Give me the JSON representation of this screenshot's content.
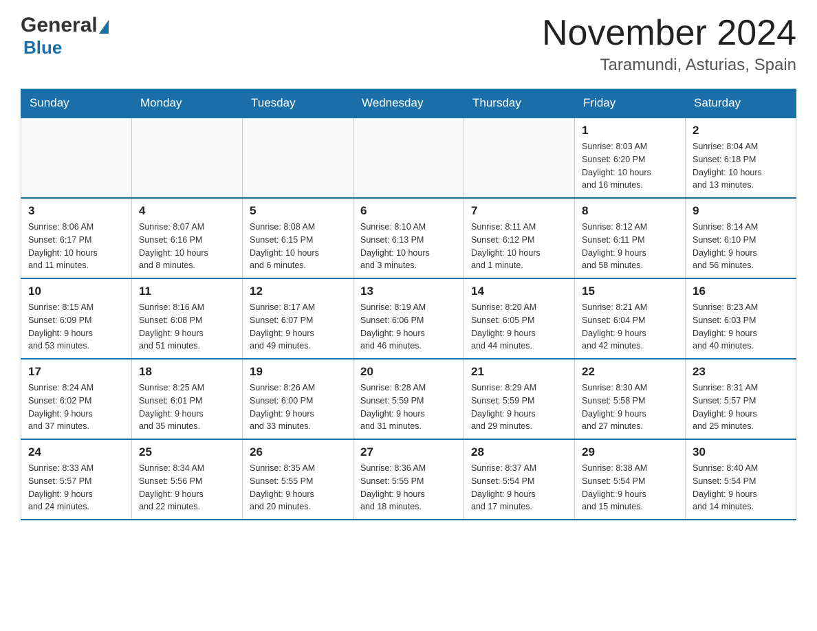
{
  "logo": {
    "general": "General",
    "triangle": "▶",
    "blue": "Blue"
  },
  "header": {
    "month": "November 2024",
    "location": "Taramundi, Asturias, Spain"
  },
  "weekdays": [
    "Sunday",
    "Monday",
    "Tuesday",
    "Wednesday",
    "Thursday",
    "Friday",
    "Saturday"
  ],
  "weeks": [
    [
      {
        "day": "",
        "info": ""
      },
      {
        "day": "",
        "info": ""
      },
      {
        "day": "",
        "info": ""
      },
      {
        "day": "",
        "info": ""
      },
      {
        "day": "",
        "info": ""
      },
      {
        "day": "1",
        "info": "Sunrise: 8:03 AM\nSunset: 6:20 PM\nDaylight: 10 hours\nand 16 minutes."
      },
      {
        "day": "2",
        "info": "Sunrise: 8:04 AM\nSunset: 6:18 PM\nDaylight: 10 hours\nand 13 minutes."
      }
    ],
    [
      {
        "day": "3",
        "info": "Sunrise: 8:06 AM\nSunset: 6:17 PM\nDaylight: 10 hours\nand 11 minutes."
      },
      {
        "day": "4",
        "info": "Sunrise: 8:07 AM\nSunset: 6:16 PM\nDaylight: 10 hours\nand 8 minutes."
      },
      {
        "day": "5",
        "info": "Sunrise: 8:08 AM\nSunset: 6:15 PM\nDaylight: 10 hours\nand 6 minutes."
      },
      {
        "day": "6",
        "info": "Sunrise: 8:10 AM\nSunset: 6:13 PM\nDaylight: 10 hours\nand 3 minutes."
      },
      {
        "day": "7",
        "info": "Sunrise: 8:11 AM\nSunset: 6:12 PM\nDaylight: 10 hours\nand 1 minute."
      },
      {
        "day": "8",
        "info": "Sunrise: 8:12 AM\nSunset: 6:11 PM\nDaylight: 9 hours\nand 58 minutes."
      },
      {
        "day": "9",
        "info": "Sunrise: 8:14 AM\nSunset: 6:10 PM\nDaylight: 9 hours\nand 56 minutes."
      }
    ],
    [
      {
        "day": "10",
        "info": "Sunrise: 8:15 AM\nSunset: 6:09 PM\nDaylight: 9 hours\nand 53 minutes."
      },
      {
        "day": "11",
        "info": "Sunrise: 8:16 AM\nSunset: 6:08 PM\nDaylight: 9 hours\nand 51 minutes."
      },
      {
        "day": "12",
        "info": "Sunrise: 8:17 AM\nSunset: 6:07 PM\nDaylight: 9 hours\nand 49 minutes."
      },
      {
        "day": "13",
        "info": "Sunrise: 8:19 AM\nSunset: 6:06 PM\nDaylight: 9 hours\nand 46 minutes."
      },
      {
        "day": "14",
        "info": "Sunrise: 8:20 AM\nSunset: 6:05 PM\nDaylight: 9 hours\nand 44 minutes."
      },
      {
        "day": "15",
        "info": "Sunrise: 8:21 AM\nSunset: 6:04 PM\nDaylight: 9 hours\nand 42 minutes."
      },
      {
        "day": "16",
        "info": "Sunrise: 8:23 AM\nSunset: 6:03 PM\nDaylight: 9 hours\nand 40 minutes."
      }
    ],
    [
      {
        "day": "17",
        "info": "Sunrise: 8:24 AM\nSunset: 6:02 PM\nDaylight: 9 hours\nand 37 minutes."
      },
      {
        "day": "18",
        "info": "Sunrise: 8:25 AM\nSunset: 6:01 PM\nDaylight: 9 hours\nand 35 minutes."
      },
      {
        "day": "19",
        "info": "Sunrise: 8:26 AM\nSunset: 6:00 PM\nDaylight: 9 hours\nand 33 minutes."
      },
      {
        "day": "20",
        "info": "Sunrise: 8:28 AM\nSunset: 5:59 PM\nDaylight: 9 hours\nand 31 minutes."
      },
      {
        "day": "21",
        "info": "Sunrise: 8:29 AM\nSunset: 5:59 PM\nDaylight: 9 hours\nand 29 minutes."
      },
      {
        "day": "22",
        "info": "Sunrise: 8:30 AM\nSunset: 5:58 PM\nDaylight: 9 hours\nand 27 minutes."
      },
      {
        "day": "23",
        "info": "Sunrise: 8:31 AM\nSunset: 5:57 PM\nDaylight: 9 hours\nand 25 minutes."
      }
    ],
    [
      {
        "day": "24",
        "info": "Sunrise: 8:33 AM\nSunset: 5:57 PM\nDaylight: 9 hours\nand 24 minutes."
      },
      {
        "day": "25",
        "info": "Sunrise: 8:34 AM\nSunset: 5:56 PM\nDaylight: 9 hours\nand 22 minutes."
      },
      {
        "day": "26",
        "info": "Sunrise: 8:35 AM\nSunset: 5:55 PM\nDaylight: 9 hours\nand 20 minutes."
      },
      {
        "day": "27",
        "info": "Sunrise: 8:36 AM\nSunset: 5:55 PM\nDaylight: 9 hours\nand 18 minutes."
      },
      {
        "day": "28",
        "info": "Sunrise: 8:37 AM\nSunset: 5:54 PM\nDaylight: 9 hours\nand 17 minutes."
      },
      {
        "day": "29",
        "info": "Sunrise: 8:38 AM\nSunset: 5:54 PM\nDaylight: 9 hours\nand 15 minutes."
      },
      {
        "day": "30",
        "info": "Sunrise: 8:40 AM\nSunset: 5:54 PM\nDaylight: 9 hours\nand 14 minutes."
      }
    ]
  ]
}
